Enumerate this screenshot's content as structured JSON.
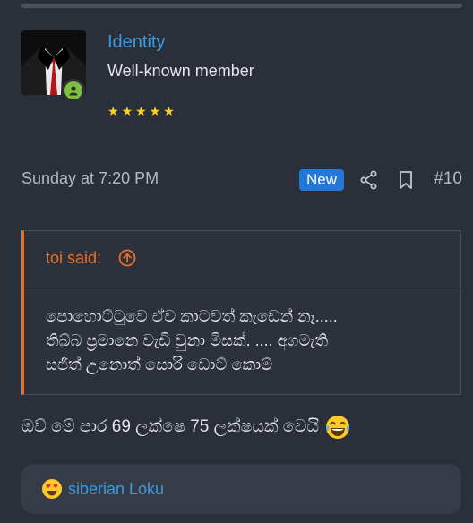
{
  "user": {
    "name": "Identity",
    "title": "Well-known member",
    "stars": [
      "★",
      "★",
      "★",
      "★",
      "★"
    ]
  },
  "post": {
    "time": "Sunday at 7:20 PM",
    "badge": "New",
    "number": "#10"
  },
  "quote": {
    "author": "toi said:",
    "lines": [
      "පොහොට්ටුවෙ ඒව කාටවත් කැඩෙන් නෑ.....",
      "තිබ්බ ප්‍රමානෙ වැඩි වුනා මිසක්. .... අගමැති",
      "සජිත් උනොත් සොරි ඩොට් කොම්"
    ]
  },
  "message": "ඔව් මේ පාර 69 ලක්ෂෙ 75 ලක්ෂයක් වෙයි",
  "reactions": {
    "user": "siberian Loku"
  },
  "colors": {
    "accent": "#3a9be0",
    "quote_accent": "#e8712a",
    "badge": "#2577d6",
    "stars": "#ffd21f",
    "online": "#7fbf3f"
  }
}
